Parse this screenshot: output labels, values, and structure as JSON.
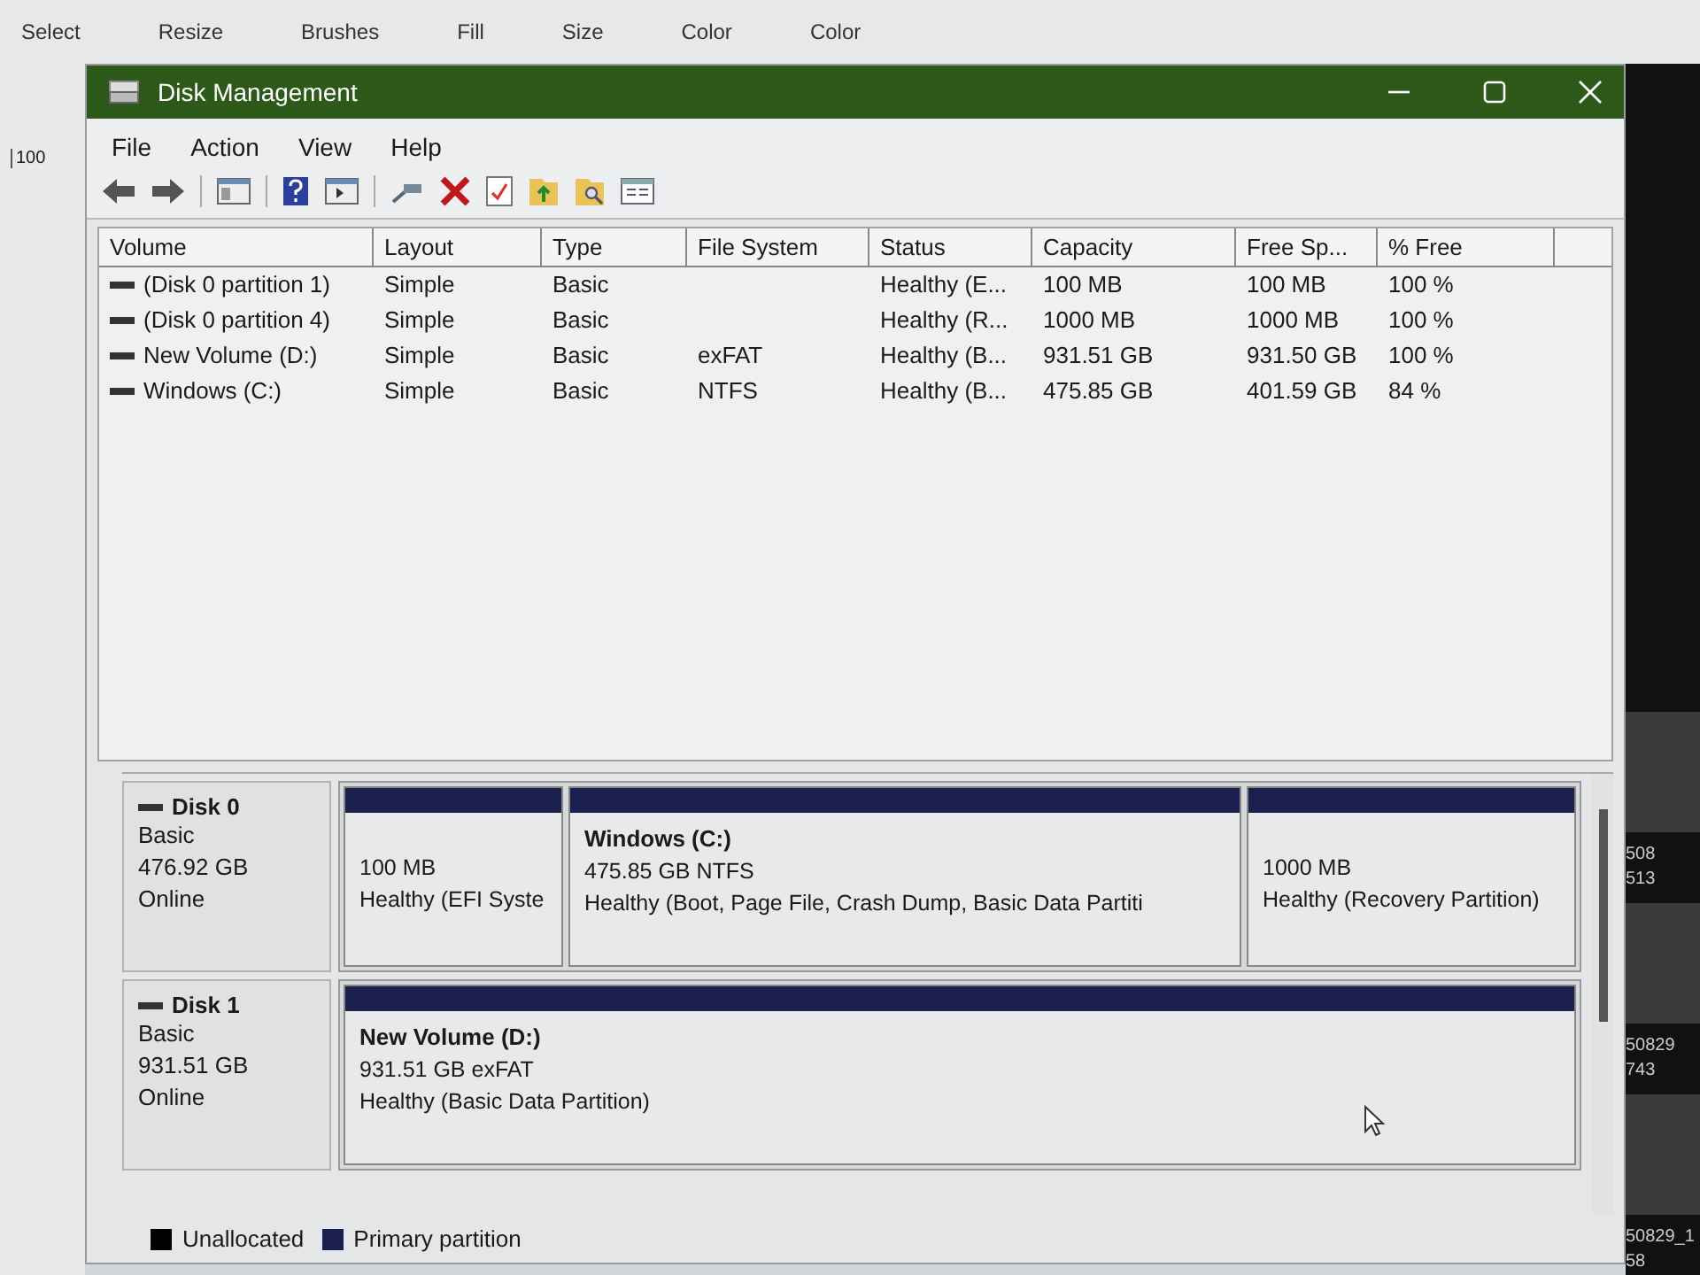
{
  "background_app": {
    "ribbon": [
      {
        "label": "Select"
      },
      {
        "label": "Resize"
      },
      {
        "label": "Brushes"
      },
      {
        "label": "Fill"
      },
      {
        "label": "Size"
      },
      {
        "label": "Color"
      },
      {
        "label": "Color"
      }
    ],
    "ruler_label": "100"
  },
  "side_thumbnails": [
    {
      "caption": [
        "508",
        "513"
      ]
    },
    {
      "caption": [
        "50829",
        "743"
      ]
    },
    {
      "caption": [
        "50829_1",
        "58"
      ]
    }
  ],
  "window": {
    "title": "Disk Management"
  },
  "menu": [
    "File",
    "Action",
    "View",
    "Help"
  ],
  "volume_table": {
    "columns": [
      "Volume",
      "Layout",
      "Type",
      "File System",
      "Status",
      "Capacity",
      "Free Sp...",
      "% Free"
    ],
    "rows": [
      [
        "(Disk 0 partition 1)",
        "Simple",
        "Basic",
        "",
        "Healthy (E...",
        "100 MB",
        "100 MB",
        "100 %"
      ],
      [
        "(Disk 0 partition 4)",
        "Simple",
        "Basic",
        "",
        "Healthy (R...",
        "1000 MB",
        "1000 MB",
        "100 %"
      ],
      [
        "New Volume (D:)",
        "Simple",
        "Basic",
        "exFAT",
        "Healthy (B...",
        "931.51 GB",
        "931.50 GB",
        "100 %"
      ],
      [
        "Windows (C:)",
        "Simple",
        "Basic",
        "NTFS",
        "Healthy (B...",
        "475.85 GB",
        "401.59 GB",
        "84 %"
      ]
    ]
  },
  "disks": [
    {
      "name": "Disk 0",
      "type": "Basic",
      "size": "476.92 GB",
      "status": "Online",
      "partitions": [
        {
          "size": "100 MB",
          "health": "Healthy (EFI Syste"
        },
        {
          "title": "Windows  (C:)",
          "size": "475.85 GB NTFS",
          "health": "Healthy (Boot, Page File, Crash Dump, Basic Data Partiti"
        },
        {
          "size": "1000 MB",
          "health": "Healthy (Recovery Partition)"
        }
      ]
    },
    {
      "name": "Disk 1",
      "type": "Basic",
      "size": "931.51 GB",
      "status": "Online",
      "partitions": [
        {
          "title": "New Volume  (D:)",
          "size": "931.51 GB exFAT",
          "health": "Healthy (Basic Data Partition)"
        }
      ]
    }
  ],
  "legend": [
    {
      "label": "Unallocated",
      "color": "#000000"
    },
    {
      "label": "Primary partition",
      "color": "#1b1f4e"
    }
  ]
}
